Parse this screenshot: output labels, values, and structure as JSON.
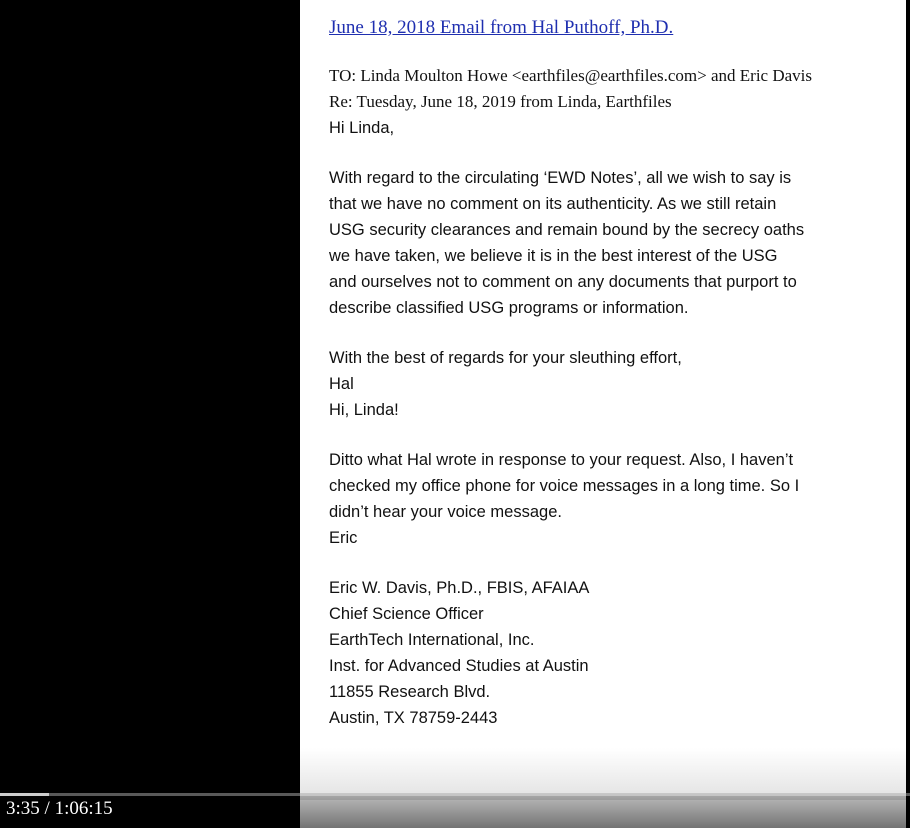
{
  "player": {
    "current_time": "3:35",
    "separator": " / ",
    "duration": "1:06:15",
    "progress_fraction": 0.054
  },
  "document": {
    "title": "June 18, 2018 Email from Hal Puthoff, Ph.D.",
    "to_line": "TO:  Linda Moulton Howe <earthfiles@earthfiles.com> and Eric Davis",
    "re_line": "Re:  Tuesday, June 18, 2019 from Linda, Earthfiles",
    "greeting_1": "Hi Linda,",
    "paragraph_1": [
      "With regard to the circulating ‘EWD Notes’, all we wish to say is",
      "that we have no comment on its authenticity. As we still retain",
      "USG security clearances and remain bound by the secrecy oaths",
      "we have taken, we believe it is in the best interest of the USG",
      "and ourselves not to comment on any documents that purport to",
      "describe classified USG programs or information."
    ],
    "closing_1": "With the best of regards for your sleuthing effort,",
    "signoff_1": "Hal",
    "greeting_2": "Hi, Linda!",
    "paragraph_2": [
      "Ditto what Hal wrote in response to your request. Also, I haven’t",
      "checked my office phone for voice messages in a long time. So I",
      "didn’t hear your voice message."
    ],
    "signoff_2": "Eric",
    "signature": [
      "Eric W. Davis, Ph.D., FBIS, AFAIAA",
      "Chief Science Officer",
      "EarthTech International, Inc.",
      "Inst. for Advanced Studies at Austin",
      "11855 Research Blvd.",
      "Austin, TX 78759-2443"
    ]
  },
  "colors": {
    "link": "#1f2fb0",
    "page": "#ffffff",
    "background": "#000000"
  }
}
